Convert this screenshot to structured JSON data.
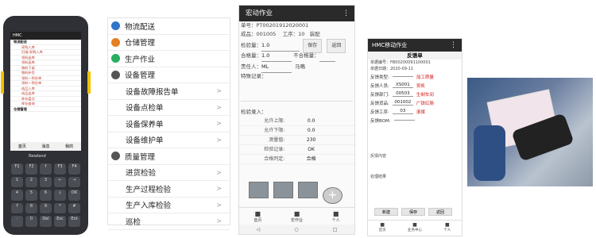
{
  "device": {
    "title": "HMC",
    "rows": [
      {
        "label": "物流配送",
        "type": "h"
      },
      {
        "label": "采购入库",
        "type": "s"
      },
      {
        "label": "扫描-采购入库",
        "type": "s"
      },
      {
        "label": "领料出库",
        "type": "s"
      },
      {
        "label": "领料出库",
        "type": "s"
      },
      {
        "label": "物料下架",
        "type": "s"
      },
      {
        "label": "物料补货",
        "type": "s"
      },
      {
        "label": "领料一到仓单",
        "type": "s"
      },
      {
        "label": "领料一到仓单",
        "type": "s"
      },
      {
        "label": "成品入库",
        "type": "s"
      },
      {
        "label": "成品出库",
        "type": "s"
      },
      {
        "label": "库存盘点",
        "type": "s"
      },
      {
        "label": "库存查询",
        "type": "s"
      },
      {
        "label": "仓储管理",
        "type": "h"
      }
    ],
    "nav": [
      "首页",
      "消息",
      "我的"
    ],
    "brand": "Newland",
    "keys": [
      "F1",
      "F2",
      "↑",
      "F3",
      "F4",
      "1",
      "2",
      "3",
      "←",
      "→",
      "4",
      "5",
      "6",
      "↓",
      "OK",
      "7",
      "8",
      "9",
      "*",
      "#",
      "·",
      "0",
      "Del",
      "Esc",
      "Ent"
    ]
  },
  "menu": {
    "items": [
      {
        "label": "物流配送",
        "type": "cat",
        "icon_color": "#2f75c9"
      },
      {
        "label": "仓储管理",
        "type": "cat",
        "icon_color": "#e67e22"
      },
      {
        "label": "生产作业",
        "type": "cat",
        "icon_color": "#27ae60"
      },
      {
        "label": "设备管理",
        "type": "cat",
        "icon_color": "#555555"
      },
      {
        "label": "设备故障报告单",
        "type": "sub"
      },
      {
        "label": "设备点检单",
        "type": "sub"
      },
      {
        "label": "设备保养单",
        "type": "sub"
      },
      {
        "label": "设备维护单",
        "type": "sub"
      },
      {
        "label": "质量管理",
        "type": "cat",
        "icon_color": "#555555"
      },
      {
        "label": "进货检验",
        "type": "sub"
      },
      {
        "label": "生产过程检验",
        "type": "sub"
      },
      {
        "label": "生产入库检验",
        "type": "sub"
      },
      {
        "label": "巡检",
        "type": "sub"
      }
    ],
    "chevron": ">"
  },
  "p3": {
    "title": "宏动作业",
    "order": "单号：PT00201912020001",
    "product_label": "成品：",
    "product": "001005",
    "proc_label": "工序：10",
    "proc_name": "装配",
    "check_qty_label": "检验量：",
    "check_qty": "1.0",
    "save": "保存",
    "back": "返回",
    "pass_qty_label": "合格量：",
    "pass_qty": "1.0",
    "fail_qty_label": "不合格量：",
    "person_label": "责任人：",
    "person": "ML",
    "person_name": "马略",
    "special_label": "特殊记录：",
    "result_label": "检验录入：",
    "rows": [
      {
        "k": "允许上限:",
        "v": "0.0"
      },
      {
        "k": "允许下限:",
        "v": "0.0"
      },
      {
        "k": "测量值:",
        "v": "230"
      },
      {
        "k": "检验记录:",
        "v": "OK"
      },
      {
        "k": "合格判定:",
        "v": "合格"
      }
    ],
    "nav": [
      "首页",
      "宏作业",
      "个人"
    ],
    "sys": [
      "◁",
      "○",
      "□"
    ]
  },
  "p4": {
    "title": "HMC移动作业",
    "form_title": "反馈单",
    "no_label": "单据编号：FB00200091100001",
    "date_label": "单据日期：2020-09-11",
    "fields": [
      {
        "k": "反馈类型:",
        "v": "",
        "red": "加工质量"
      },
      {
        "k": "反馈人员:",
        "v": "XS001",
        "red": "吴凯"
      },
      {
        "k": "反馈部门:",
        "v": "00503",
        "red": "生制车间"
      },
      {
        "k": "反馈货品:",
        "v": "001002",
        "red": "广铁红肠"
      },
      {
        "k": "反馈工序:",
        "v": "03",
        "red": "滚揉"
      },
      {
        "k": "反馈BOM:",
        "v": "",
        "red": ""
      }
    ],
    "content_label": "反馈内容",
    "handle_label": "处理结果",
    "buttons": [
      "新建",
      "保存",
      "返回"
    ],
    "nav": [
      "首页",
      "业务中心",
      "个人"
    ]
  },
  "colors": {
    "accent": "#2a2a2a",
    "red": "#d01818"
  }
}
